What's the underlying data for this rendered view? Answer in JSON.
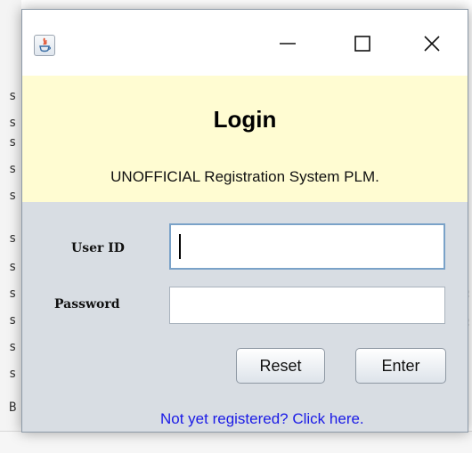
{
  "window": {
    "title": "",
    "icon": "java-app-icon",
    "controls": {
      "minimize_icon": "minimize-icon",
      "maximize_icon": "maximize-icon",
      "close_icon": "close-icon"
    }
  },
  "header": {
    "title": "Login",
    "subtitle": "UNOFFICIAL Registration System PLM."
  },
  "form": {
    "user_id_label": "User ID",
    "user_id_value": "",
    "password_label": "Password",
    "password_value": ""
  },
  "buttons": {
    "reset_label": "Reset",
    "enter_label": "Enter"
  },
  "register_link": "Not yet registered? Click here.",
  "colors": {
    "header_bg": "#fffcd2",
    "panel_bg": "#d8dde3",
    "link": "#1a1ae6"
  }
}
